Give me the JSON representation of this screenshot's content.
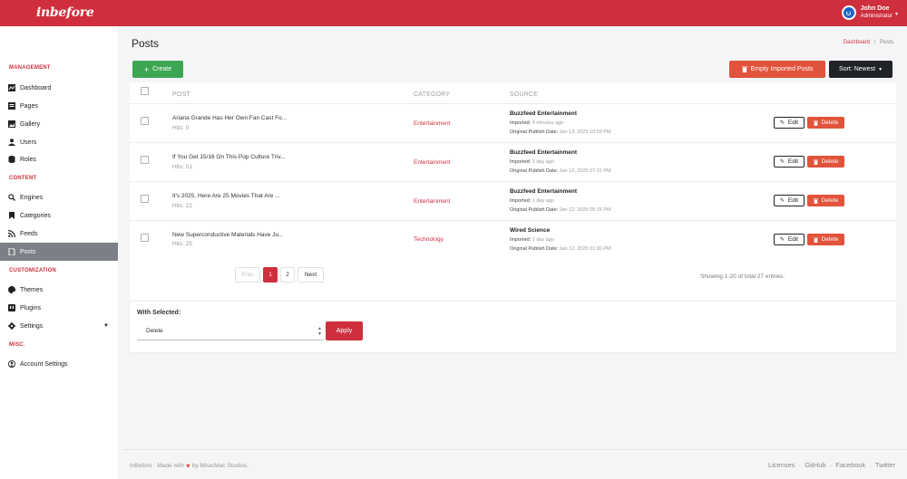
{
  "app": {
    "logo": "inbefore",
    "user_name": "John Doe",
    "user_role": "Administrator"
  },
  "sidebar": {
    "sections": [
      {
        "title": "MANAGEMENT",
        "items": [
          {
            "label": "Dashboard",
            "icon": "chart-icon"
          },
          {
            "label": "Pages",
            "icon": "pages-icon"
          },
          {
            "label": "Gallery",
            "icon": "image-icon"
          },
          {
            "label": "Users",
            "icon": "user-icon"
          },
          {
            "label": "Roles",
            "icon": "database-icon"
          }
        ]
      },
      {
        "title": "CONTENT",
        "items": [
          {
            "label": "Engines",
            "icon": "search-icon"
          },
          {
            "label": "Categories",
            "icon": "bookmark-icon"
          },
          {
            "label": "Feeds",
            "icon": "rss-icon"
          },
          {
            "label": "Posts",
            "icon": "file-icon",
            "active": true
          }
        ]
      },
      {
        "title": "CUSTOMIZATION",
        "items": [
          {
            "label": "Themes",
            "icon": "palette-icon"
          },
          {
            "label": "Plugins",
            "icon": "plugin-icon"
          },
          {
            "label": "Settings",
            "icon": "gear-icon"
          }
        ]
      },
      {
        "title": "MISC.",
        "items": [
          {
            "label": "Account Settings",
            "icon": "account-icon"
          }
        ]
      }
    ]
  },
  "header": {
    "title": "Posts",
    "breadcrumb": [
      "Dashboard",
      "Posts"
    ],
    "breadcrumb_sep": "/"
  },
  "toolbar": {
    "create_label": "Create",
    "empty_label": "Empty Imported Posts",
    "sort_label": "Sort: Newest"
  },
  "table": {
    "columns": [
      "POST",
      "CATEGORY",
      "SOURCE"
    ],
    "edit_label": "Edit",
    "delete_label": "Delete",
    "imported_label": "Imported:",
    "original_label": "Original Publish Date:",
    "rows": [
      {
        "title": "Ariana Grande Has Her Own Fan Cast Fo...",
        "hits": "Hits: 0",
        "category": "Entertainment",
        "source": "Buzzfeed Entertainment",
        "imported": "4 minutes ago",
        "original": "Jan 13, 2025 10:59 PM"
      },
      {
        "title": "If You Get 15/16 On This Pop Culture Triv...",
        "hits": "Hits: 51",
        "category": "Entertainment",
        "source": "Buzzfeed Entertainment",
        "imported": "1 day ago",
        "original": "Jan 12, 2025 07:31 PM"
      },
      {
        "title": "It's 2025, Here Are 25 Movies That Are ...",
        "hits": "Hits: 22",
        "category": "Entertainment",
        "source": "Buzzfeed Entertainment",
        "imported": "1 day ago",
        "original": "Jan 12, 2025 05:16 PM"
      },
      {
        "title": "New Superconductive Materials Have Ju...",
        "hits": "Hits: 25",
        "category": "Technology",
        "source": "Wired Science",
        "imported": "1 day ago",
        "original": "Jan 12, 2025 01:00 PM"
      }
    ]
  },
  "pagination": {
    "prev": "Prev",
    "pages": [
      "1",
      "2"
    ],
    "next": "Next",
    "showing": "Showing 1-20 of total 27 entries."
  },
  "bulk": {
    "label": "With Selected:",
    "selected_option": "Delete",
    "apply_label": "Apply"
  },
  "footer": {
    "left_prefix": "InBefore · Made with",
    "left_suffix": "by MiracMac Studios.",
    "links": [
      "Licenses",
      "GitHub",
      "Facebook",
      "Twitter"
    ],
    "sep": "·"
  },
  "colors": {
    "brand": "#cf2f3d",
    "create": "#3ea652",
    "danger": "#e2533b",
    "dark": "#1f2327"
  }
}
